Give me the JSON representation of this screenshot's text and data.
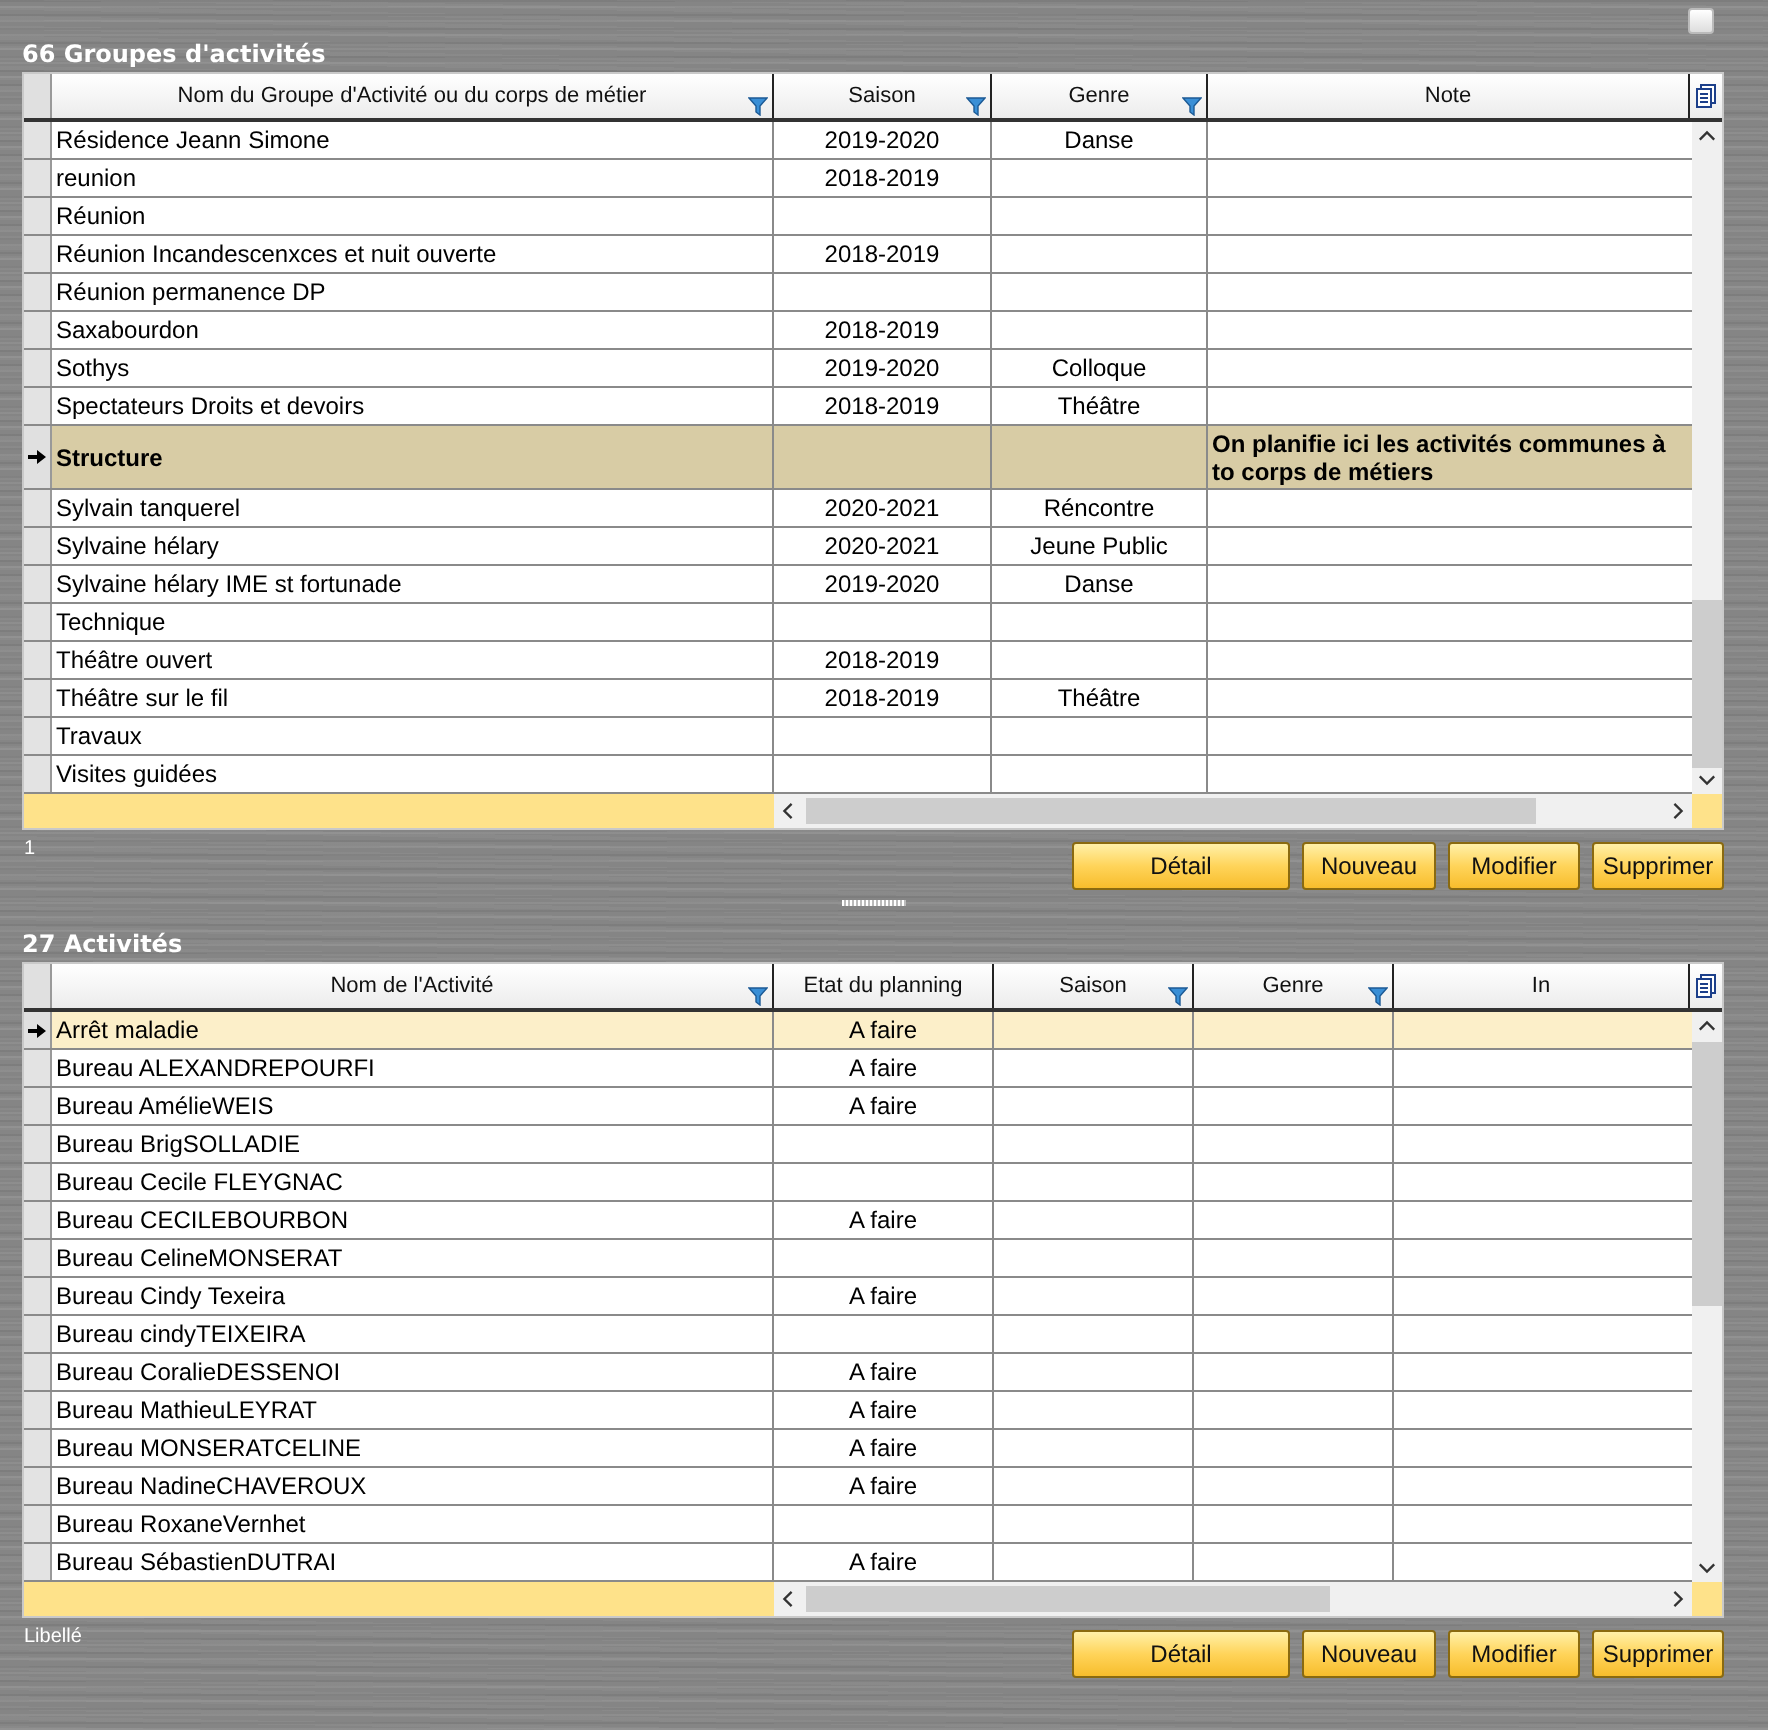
{
  "corner_checkbox": {
    "checked": false
  },
  "grids": [
    {
      "title": "66 Groupes d'activités",
      "columns": [
        {
          "label": "Nom du Groupe d'Activité ou du corps de métier",
          "filter": true
        },
        {
          "label": "Saison",
          "filter": true
        },
        {
          "label": "Genre",
          "filter": true
        },
        {
          "label": "Note",
          "filter": false
        }
      ],
      "rows": [
        {
          "cells": [
            "Résidence Jeann Simone",
            "2019-2020",
            "Danse",
            ""
          ],
          "selected": false
        },
        {
          "cells": [
            "reunion",
            "2018-2019",
            "",
            ""
          ],
          "selected": false
        },
        {
          "cells": [
            "Réunion",
            "",
            "",
            ""
          ],
          "selected": false
        },
        {
          "cells": [
            "Réunion Incandescenxces et nuit ouverte",
            "2018-2019",
            "",
            ""
          ],
          "selected": false
        },
        {
          "cells": [
            "Réunion permanence DP",
            "",
            "",
            ""
          ],
          "selected": false
        },
        {
          "cells": [
            "Saxabourdon",
            "2018-2019",
            "",
            ""
          ],
          "selected": false
        },
        {
          "cells": [
            "Sothys",
            "2019-2020",
            "Colloque",
            ""
          ],
          "selected": false
        },
        {
          "cells": [
            "Spectateurs Droits et devoirs",
            "2018-2019",
            "Théâtre",
            ""
          ],
          "selected": false
        },
        {
          "cells": [
            "Structure",
            "",
            "",
            "On planifie ici les activités communes à to corps de métiers"
          ],
          "selected": true
        },
        {
          "cells": [
            "Sylvain tanquerel",
            "2020-2021",
            "Réncontre",
            ""
          ],
          "selected": false
        },
        {
          "cells": [
            "Sylvaine hélary",
            "2020-2021",
            "Jeune Public",
            ""
          ],
          "selected": false
        },
        {
          "cells": [
            "Sylvaine hélary IME st fortunade",
            "2019-2020",
            "Danse",
            ""
          ],
          "selected": false
        },
        {
          "cells": [
            "Technique",
            "",
            "",
            ""
          ],
          "selected": false
        },
        {
          "cells": [
            "Théâtre ouvert",
            "2018-2019",
            "",
            ""
          ],
          "selected": false
        },
        {
          "cells": [
            "Théâtre sur le fil",
            "2018-2019",
            "Théâtre",
            ""
          ],
          "selected": false
        },
        {
          "cells": [
            "Travaux",
            "",
            "",
            ""
          ],
          "selected": false
        },
        {
          "cells": [
            "Visites guidées",
            "",
            "",
            ""
          ],
          "selected": false
        }
      ],
      "footer_label": "1",
      "buttons": [
        "Détail",
        "Nouveau",
        "Modifier",
        "Supprimer"
      ]
    },
    {
      "title": "27 Activités",
      "columns": [
        {
          "label": "Nom de l'Activité",
          "filter": true
        },
        {
          "label": "Etat du planning",
          "filter": false
        },
        {
          "label": "Saison",
          "filter": true
        },
        {
          "label": "Genre",
          "filter": true
        },
        {
          "label": "In",
          "filter": false
        }
      ],
      "rows": [
        {
          "cells": [
            "Arrêt maladie",
            "A faire",
            "",
            "",
            ""
          ],
          "selected": true
        },
        {
          "cells": [
            "Bureau ALEXANDREPOURFI",
            "A faire",
            "",
            "",
            ""
          ],
          "selected": false
        },
        {
          "cells": [
            "Bureau AmélieWEIS",
            "A faire",
            "",
            "",
            ""
          ],
          "selected": false
        },
        {
          "cells": [
            "Bureau BrigSOLLADIE",
            "",
            "",
            "",
            ""
          ],
          "selected": false
        },
        {
          "cells": [
            "Bureau Cecile FLEYGNAC",
            "",
            "",
            "",
            ""
          ],
          "selected": false
        },
        {
          "cells": [
            "Bureau CECILEBOURBON",
            "A faire",
            "",
            "",
            ""
          ],
          "selected": false
        },
        {
          "cells": [
            "Bureau CelineMONSERAT",
            "",
            "",
            "",
            ""
          ],
          "selected": false
        },
        {
          "cells": [
            "Bureau Cindy Texeira",
            "A faire",
            "",
            "",
            ""
          ],
          "selected": false
        },
        {
          "cells": [
            "Bureau cindyTEIXEIRA",
            "",
            "",
            "",
            ""
          ],
          "selected": false
        },
        {
          "cells": [
            "Bureau CoralieDESSENOI",
            "A faire",
            "",
            "",
            ""
          ],
          "selected": false
        },
        {
          "cells": [
            "Bureau MathieuLEYRAT",
            "A faire",
            "",
            "",
            ""
          ],
          "selected": false
        },
        {
          "cells": [
            "Bureau MONSERATCELINE",
            "A faire",
            "",
            "",
            ""
          ],
          "selected": false
        },
        {
          "cells": [
            "Bureau NadineCHAVEROUX",
            "A faire",
            "",
            "",
            ""
          ],
          "selected": false
        },
        {
          "cells": [
            "Bureau RoxaneVernhet",
            "",
            "",
            "",
            ""
          ],
          "selected": false
        },
        {
          "cells": [
            "Bureau SébastienDUTRAI",
            "A faire",
            "",
            "",
            ""
          ],
          "selected": false
        }
      ],
      "footer_label": "Libellé",
      "buttons": [
        "Détail",
        "Nouveau",
        "Modifier",
        "Supprimer"
      ]
    }
  ]
}
